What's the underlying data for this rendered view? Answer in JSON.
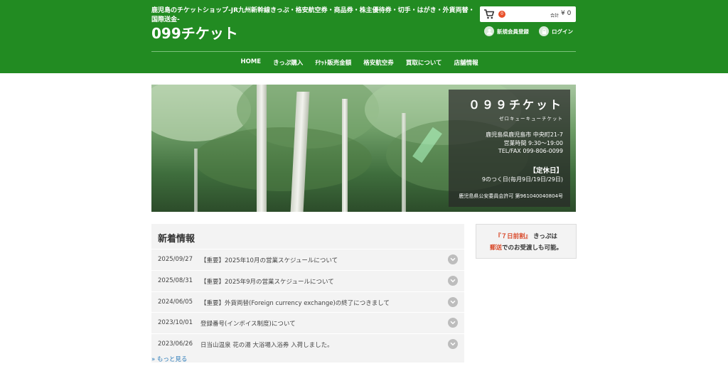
{
  "header": {
    "tagline": "鹿児島のチケットショップ-JR九州新幹線きっぷ・格安航空券・商品券・株主優待券・切手・はがき・外貨両替・国際送金-",
    "logo": "099チケット",
    "cart": {
      "count": "0",
      "total_label": "合計",
      "total_value": "¥ 0"
    },
    "register_label": "新規会員登録",
    "login_label": "ログイン"
  },
  "nav": {
    "items": [
      {
        "label": "HOME"
      },
      {
        "label": "きっぷ購入"
      },
      {
        "label": "ﾁｹｯﾄ販売金額"
      },
      {
        "label": "格安航空券"
      },
      {
        "label": "買取について"
      },
      {
        "label": "店舗情報"
      }
    ]
  },
  "hero": {
    "title": "０９９チケット",
    "kana": "ゼロキューキューチケット",
    "address": "鹿児島県鹿児島市 中央町21-7",
    "hours": "営業時間 9:30～19:00",
    "tel": "TEL/FAX 099-806-0099",
    "holiday_title": "【定休日】",
    "holiday_text": "9のつく日(毎月9日/19日/29日)",
    "license": "鹿児島県公安委員会許可 第961040040804号"
  },
  "news": {
    "title": "新着情報",
    "items": [
      {
        "date": "2025/09/27",
        "text": "【重要】2025年10月の営業スケジュールについて"
      },
      {
        "date": "2025/08/31",
        "text": "【重要】2025年9月の営業スケジュールについて"
      },
      {
        "date": "2024/06/05",
        "text": "【重要】外貨両替(Foreign currency exchange)の終了につきまして"
      },
      {
        "date": "2023/10/01",
        "text": "登録番号(インボイス制度)について"
      },
      {
        "date": "2023/06/26",
        "text": "日当山温泉 花の湯 大浴場入浴券 入荷しました。"
      }
    ],
    "more_label": "» もっと見る"
  },
  "promo": {
    "highlight1": "『７日前割』",
    "text1": "きっぷは",
    "highlight2": "郵送",
    "text2": "でのお受渡しも可能。"
  },
  "colors": {
    "brand_green": "#228b22",
    "accent_red": "#d94a2b",
    "link_blue": "#2b7bb9"
  }
}
